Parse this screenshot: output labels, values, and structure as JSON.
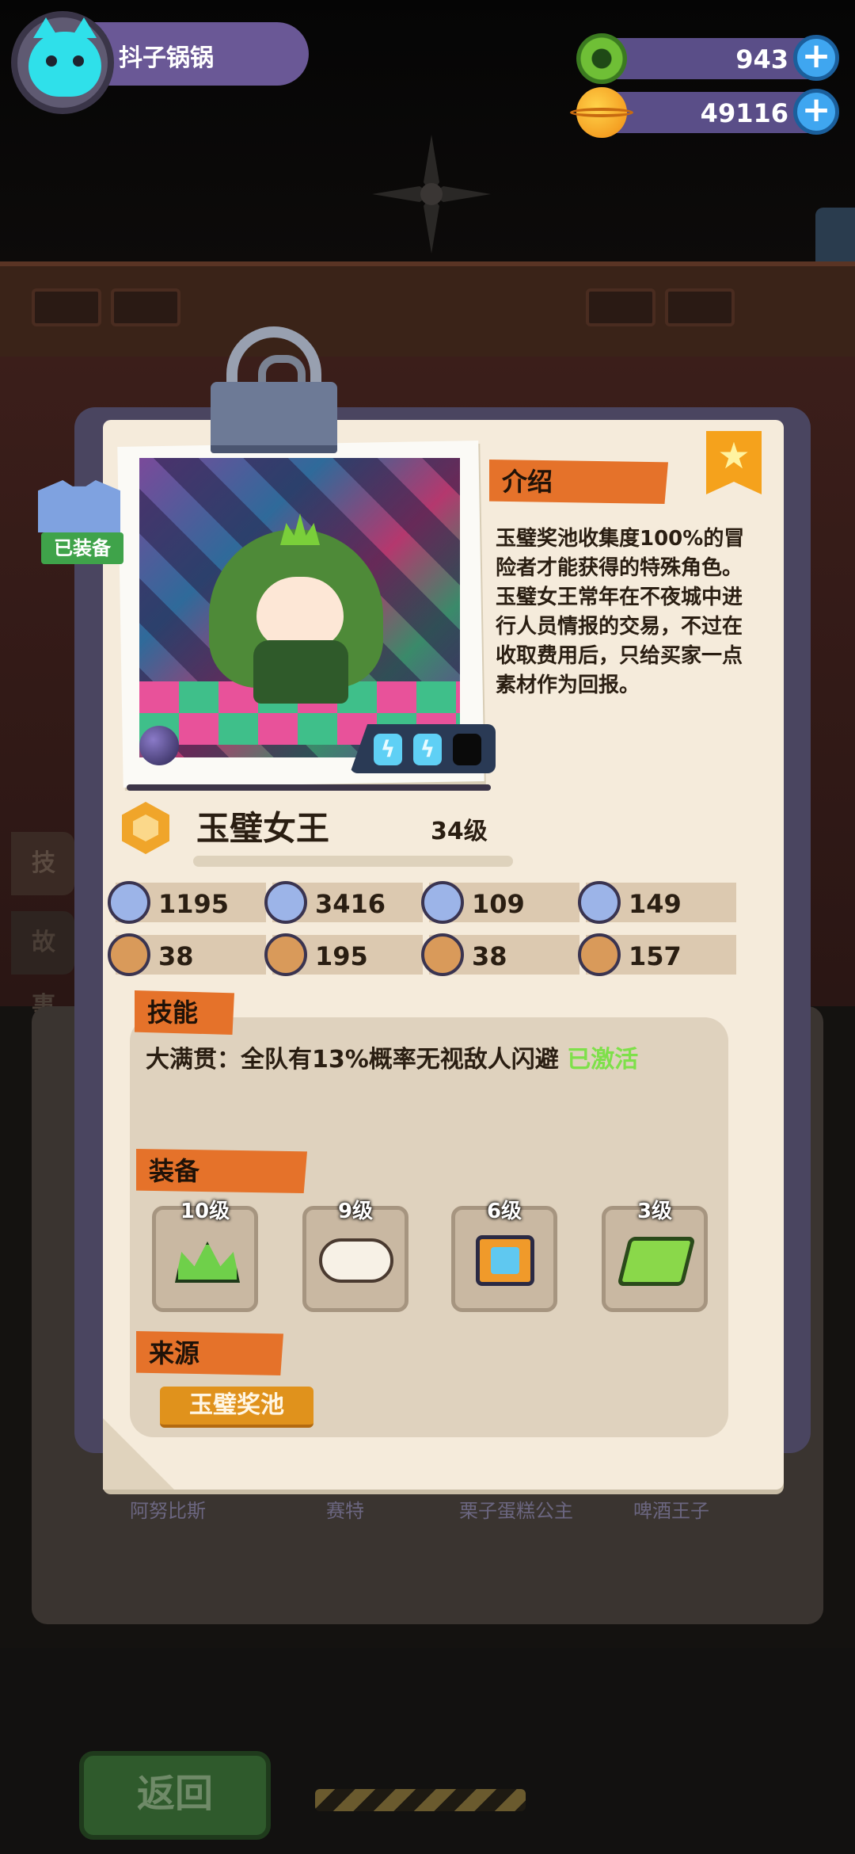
{
  "player": {
    "name": "抖子锅锅"
  },
  "currencies": [
    {
      "icon": "green-gem-coin-icon",
      "value": "943"
    },
    {
      "icon": "planet-coin-icon",
      "value": "49116"
    }
  ],
  "hero_card": {
    "equipped_label": "已装备",
    "intro_title": "介绍",
    "intro_text": "玉璧奖池收集度100%的冒险者才能获得的特殊角色。玉璧女王常年在不夜城中进行人员情报的交易，不过在收取费用后，只给买家一点素材作为回报。",
    "name": "玉璧女王",
    "level": "34级",
    "energy": {
      "filled": 2,
      "total": 3
    },
    "stats": [
      {
        "icon": "health-shield-icon",
        "value": "1195",
        "color": "blue"
      },
      {
        "icon": "attack-icon",
        "value": "3416",
        "color": "blue"
      },
      {
        "icon": "defense-shield-icon",
        "value": "109",
        "color": "blue"
      },
      {
        "icon": "speed-icon",
        "value": "149",
        "color": "blue"
      },
      {
        "icon": "strength-icon",
        "value": "38",
        "color": "orange"
      },
      {
        "icon": "charm-icon",
        "value": "195",
        "color": "orange"
      },
      {
        "icon": "muscle-icon",
        "value": "38",
        "color": "orange"
      },
      {
        "icon": "brain-icon",
        "value": "157",
        "color": "orange"
      }
    ],
    "skills_title": "技能",
    "skill": {
      "text": "大满贯：全队有13%概率无视敌人闪避",
      "status": "已激活"
    },
    "equipment_title": "装备",
    "equipment": [
      {
        "level": "10级",
        "icon": "crown-icon"
      },
      {
        "level": "9级",
        "icon": "cloud-icon"
      },
      {
        "level": "6级",
        "icon": "treasure-box-icon"
      },
      {
        "level": "3级",
        "icon": "green-book-icon"
      }
    ],
    "source_title": "来源",
    "source_value": "玉璧奖池"
  },
  "background": {
    "side_tabs": [
      "技能",
      "故事"
    ],
    "chips": [
      "阿努比斯",
      "赛特",
      "栗子蛋糕公主",
      "啤酒王子"
    ],
    "back_button": "返回"
  },
  "colors": {
    "accent_orange": "#e5722a",
    "card_paper": "#f5ebdb",
    "skill_active": "#7ee04a",
    "currency_bar": "#5a4e88"
  }
}
